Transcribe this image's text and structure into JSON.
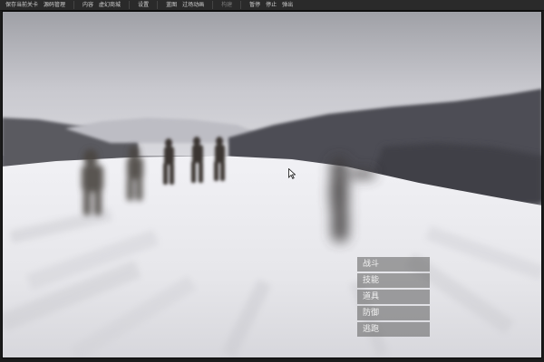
{
  "toolbar": {
    "items": [
      {
        "label": "保存当前关卡",
        "enabled": true
      },
      {
        "label": "源码管理",
        "enabled": true
      },
      {
        "label": "内容",
        "enabled": true
      },
      {
        "label": "虚幻商城",
        "enabled": true
      },
      {
        "label": "设置",
        "enabled": true
      },
      {
        "label": "蓝图",
        "enabled": true
      },
      {
        "label": "过场动画",
        "enabled": true
      },
      {
        "label": "构建",
        "enabled": false
      },
      {
        "label": "暂停",
        "enabled": true
      },
      {
        "label": "停止",
        "enabled": true
      },
      {
        "label": "弹出",
        "enabled": true
      }
    ]
  },
  "battle_menu": {
    "items": [
      {
        "label": "战斗"
      },
      {
        "label": "技能"
      },
      {
        "label": "道具"
      },
      {
        "label": "防御"
      },
      {
        "label": "逃跑"
      }
    ]
  },
  "colors": {
    "toolbar_bg": "#2a2a2a",
    "menu_item_bg": "#6e6e6e",
    "sky": "#c9c9cf",
    "snow": "#e9e9ee"
  }
}
